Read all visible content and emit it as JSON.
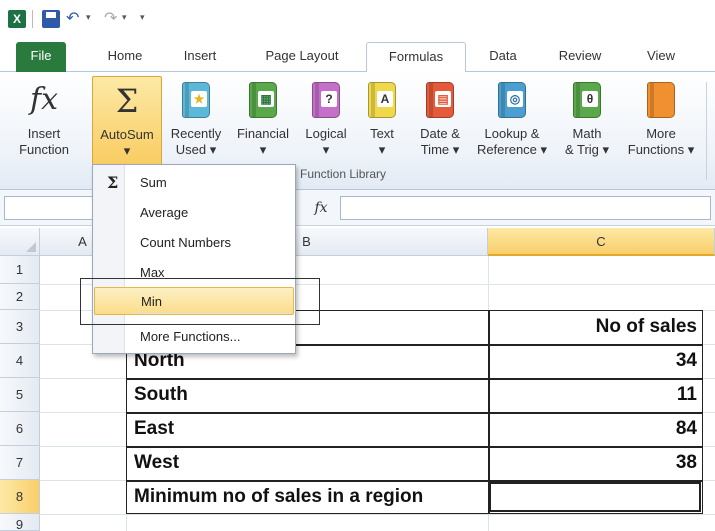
{
  "qat": {
    "app_icon": "X"
  },
  "tabs": [
    {
      "label": "File"
    },
    {
      "label": "Home"
    },
    {
      "label": "Insert"
    },
    {
      "label": "Page Layout"
    },
    {
      "label": "Formulas"
    },
    {
      "label": "Data"
    },
    {
      "label": "Review"
    },
    {
      "label": "View"
    }
  ],
  "ribbon": {
    "insert_function": "Insert\nFunction",
    "autosum": "AutoSum\n▾",
    "recently_used": "Recently\nUsed ▾",
    "financial": "Financial\n▾",
    "logical": "Logical\n▾",
    "text": "Text\n▾",
    "date_time": "Date &\nTime ▾",
    "lookup": "Lookup &\nReference ▾",
    "math": "Math\n& Trig ▾",
    "more": "More\nFunctions ▾",
    "group_label": "Function Library",
    "logical_glyph": "?",
    "text_glyph": "A",
    "math_glyph": "θ"
  },
  "formula_bar": {
    "fx": "fx"
  },
  "autosum_menu": {
    "items": [
      "Sum",
      "Average",
      "Count Numbers",
      "Max",
      "Min",
      "More Functions..."
    ]
  },
  "grid": {
    "columns": [
      "A",
      "B",
      "C"
    ],
    "rows": [
      "1",
      "2",
      "3",
      "4",
      "5",
      "6",
      "7",
      "8",
      "9"
    ],
    "header_c": "No of sales",
    "data": [
      {
        "region": "North",
        "sales": "34"
      },
      {
        "region": "South",
        "sales": "11"
      },
      {
        "region": "East",
        "sales": "84"
      },
      {
        "region": "West",
        "sales": "38"
      }
    ],
    "min_label": "Minimum no of sales in a region"
  },
  "colors": {
    "file_tab": "#2a7a3e",
    "selected": "#f8c95a"
  }
}
